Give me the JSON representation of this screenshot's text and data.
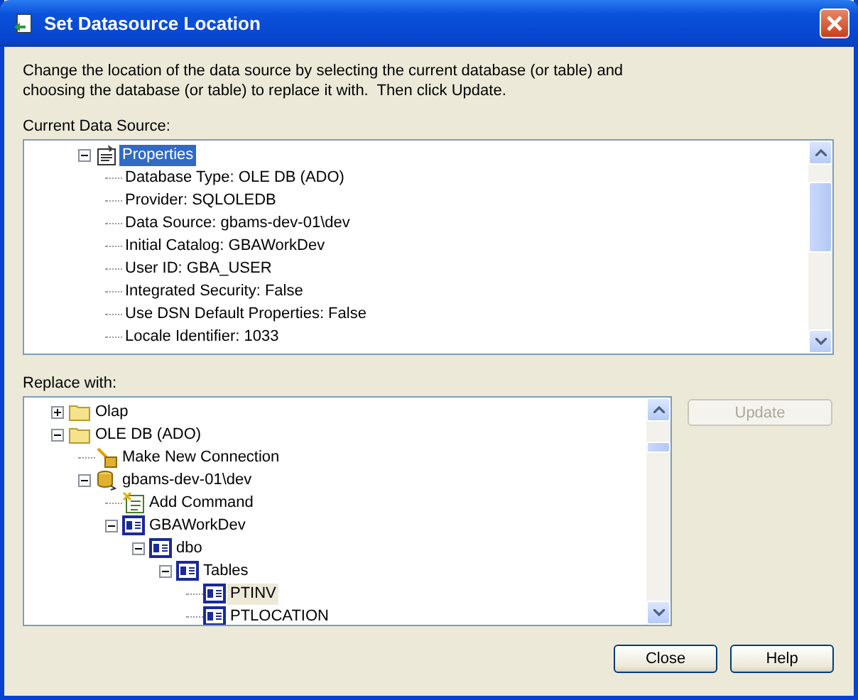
{
  "window": {
    "title": "Set Datasource Location"
  },
  "instructions": [
    "Change the location of the data source by selecting the current database (or table) and",
    "choosing the database (or table) to replace it with.  Then click Update."
  ],
  "current_source": {
    "label": "Current Data Source:",
    "focused": true,
    "nodes": [
      {
        "label": "Properties",
        "kind": "properties",
        "expanded": true,
        "selected": true,
        "children": [
          {
            "label": "Database Type: OLE DB (ADO)",
            "selected": false
          },
          {
            "label": "Provider: SQLOLEDB",
            "selected": false
          },
          {
            "label": "Data Source: gbams-dev-01\\dev",
            "selected": false
          },
          {
            "label": "Initial Catalog: GBAWorkDev",
            "selected": false
          },
          {
            "label": "User ID: GBA_USER",
            "selected": false
          },
          {
            "label": "Integrated Security: False",
            "selected": false
          },
          {
            "label": "Use DSN Default Properties: False",
            "selected": false
          },
          {
            "label": "Locale Identifier: 1033",
            "selected": false
          }
        ]
      }
    ]
  },
  "replace_with": {
    "label": "Replace with:",
    "focused": false,
    "nodes": [
      {
        "label": "Olap",
        "kind": "folder",
        "expanded": false,
        "selected": false
      },
      {
        "label": "OLE DB (ADO)",
        "kind": "folder",
        "expanded": true,
        "selected": false,
        "children": [
          {
            "label": "Make New Connection",
            "kind": "wizard",
            "selected": false
          },
          {
            "label": "gbams-dev-01\\dev",
            "kind": "server",
            "expanded": true,
            "selected": false,
            "children": [
              {
                "label": "Add Command",
                "kind": "command",
                "selected": false
              },
              {
                "label": "GBAWorkDev",
                "kind": "table",
                "expanded": true,
                "selected": false,
                "children": [
                  {
                    "label": "dbo",
                    "kind": "table",
                    "expanded": true,
                    "selected": false,
                    "children": [
                      {
                        "label": "Tables",
                        "kind": "table",
                        "expanded": true,
                        "selected": false,
                        "children": [
                          {
                            "label": "PTINV",
                            "kind": "table",
                            "selected": true
                          },
                          {
                            "label": "PTLOCATION",
                            "kind": "table",
                            "selected": false
                          }
                        ]
                      }
                    ]
                  }
                ]
              }
            ]
          }
        ]
      }
    ]
  },
  "update_button": {
    "label": "Update",
    "disabled": true
  },
  "buttons": [
    "Close",
    "Help"
  ]
}
